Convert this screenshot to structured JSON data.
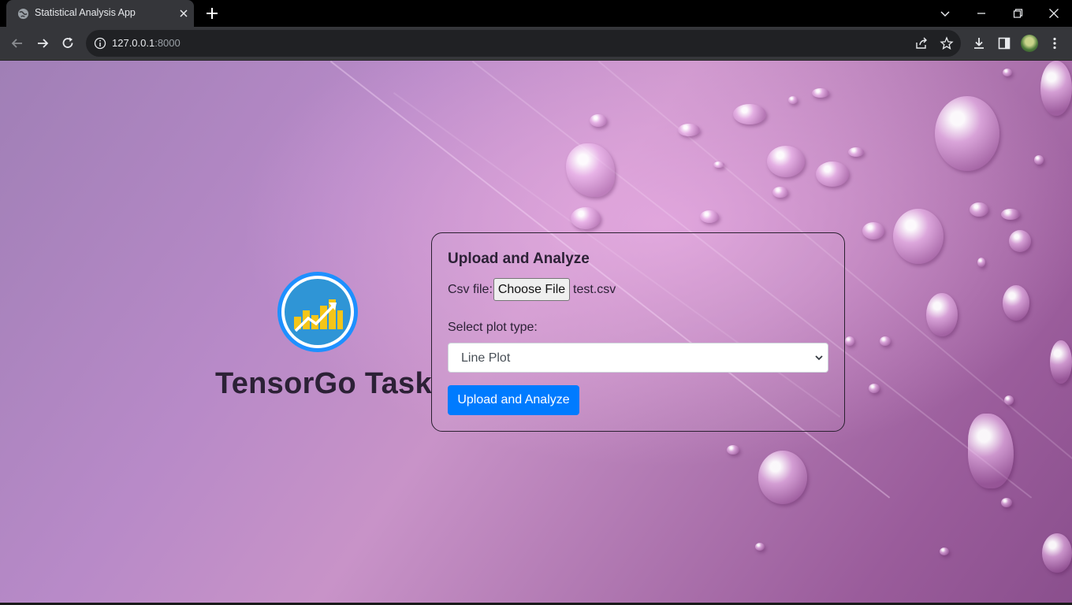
{
  "browser": {
    "tab": {
      "title": "Statistical Analysis App",
      "favicon": "globe-icon"
    },
    "url": {
      "host": "127.0.0.1",
      "port": ":8000"
    }
  },
  "page": {
    "brand": "TensorGo Task",
    "form": {
      "title": "Upload and Analyze",
      "file_label": "Csv file:",
      "file_button": "Choose File",
      "file_name": "test.csv",
      "plot_label": "Select plot type:",
      "plot_selected": "Line Plot",
      "submit": "Upload and Analyze"
    }
  },
  "colors": {
    "primary_button": "#007bff",
    "logo_ring": "#1e90ff",
    "text": "#2c2136"
  }
}
